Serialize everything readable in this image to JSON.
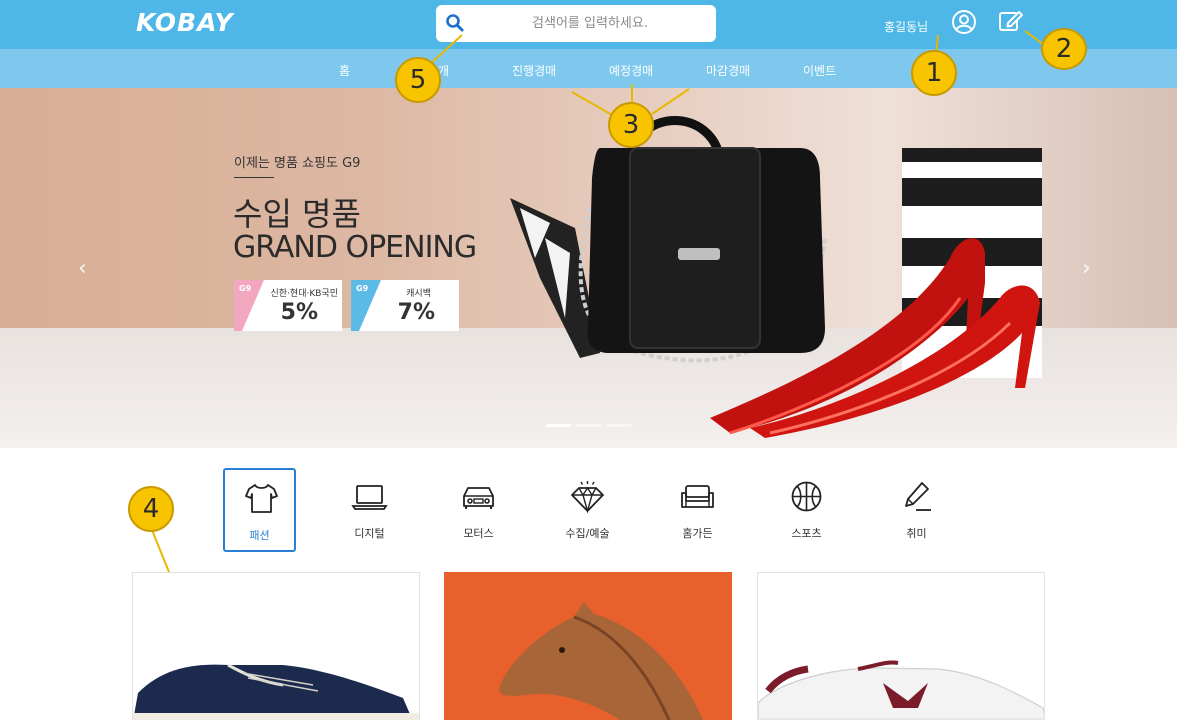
{
  "header": {
    "logo": "KOBAY",
    "search_placeholder": "검색어를 입력하세요.",
    "username": "홍길동님"
  },
  "nav": {
    "items": [
      "홈",
      "소개",
      "진행경매",
      "예정경매",
      "마감경매",
      "이벤트"
    ]
  },
  "hero": {
    "subtitle": "이제는 명품 쇼핑도 G9",
    "title_line1": "수입 명품",
    "title_line2": "GRAND OPENING",
    "coupons": [
      {
        "label": "신한·현대·KB국민",
        "value": "5%",
        "color": "#f2a7bf"
      },
      {
        "label": "캐시백",
        "value": "7%",
        "color": "#5bbbe6"
      }
    ],
    "coupon_badge": "G9",
    "prev_arrow": "‹",
    "next_arrow": "›"
  },
  "categories": {
    "items": [
      {
        "label": "패션",
        "icon": "tshirt-icon"
      },
      {
        "label": "디지털",
        "icon": "laptop-icon"
      },
      {
        "label": "모터스",
        "icon": "car-icon"
      },
      {
        "label": "수집/예술",
        "icon": "diamond-icon"
      },
      {
        "label": "홈가든",
        "icon": "sofa-icon"
      },
      {
        "label": "스포츠",
        "icon": "basketball-icon"
      },
      {
        "label": "취미",
        "icon": "pencil-icon"
      }
    ],
    "selected": "패션"
  },
  "annotations": [
    "1",
    "2",
    "3",
    "4",
    "5"
  ],
  "colors": {
    "header": "#4fb7e8",
    "nav": "#7ec8ee",
    "accent": "#2a7fd4",
    "bubble": "#f8c400"
  }
}
